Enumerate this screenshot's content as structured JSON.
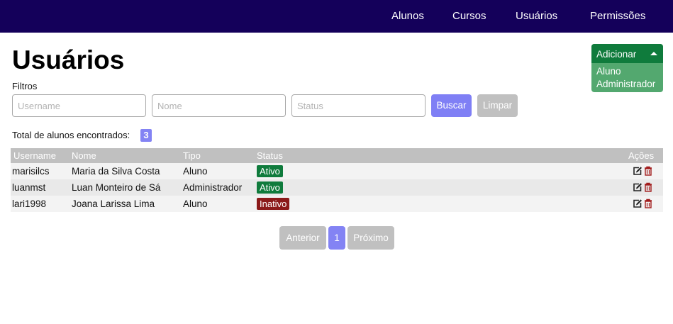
{
  "nav": {
    "links": [
      "Alunos",
      "Cursos",
      "Usuários",
      "Permissões"
    ]
  },
  "page": {
    "title": "Usuários"
  },
  "add_menu": {
    "label": "Adicionar",
    "options": [
      "Aluno",
      "Administrador"
    ]
  },
  "filters": {
    "label": "Filtros",
    "username": {
      "value": "",
      "placeholder": "Username"
    },
    "name": {
      "value": "",
      "placeholder": "Nome"
    },
    "status": {
      "value": "",
      "placeholder": "Status"
    },
    "search_label": "Buscar",
    "clear_label": "Limpar"
  },
  "summary": {
    "label": "Total de alunos encontrados:",
    "count": "3"
  },
  "table": {
    "headers": [
      "Username",
      "Nome",
      "Tipo",
      "Status",
      "Ações"
    ],
    "rows": [
      {
        "username": "marisilcs",
        "name": "Maria da Silva Costa",
        "type": "Aluno",
        "status": "Ativo"
      },
      {
        "username": "luanmst",
        "name": "Luan Monteiro de Sá",
        "type": "Administrador",
        "status": "Ativo"
      },
      {
        "username": "lari1998",
        "name": "Joana Larissa Lima",
        "type": "Aluno",
        "status": "Inativo"
      }
    ]
  },
  "pagination": {
    "prev_label": "Anterior",
    "current_page": "1",
    "next_label": "Próximo"
  },
  "colors": {
    "navbar": "#14005a",
    "primary": "#7f7ff5",
    "success": "#0f7b3c",
    "danger": "#8b1a1a",
    "disabled": "#c0c0c0"
  },
  "icons": {
    "edit": "edit-icon",
    "delete": "trash-icon",
    "dropdown": "caret-up-icon"
  }
}
